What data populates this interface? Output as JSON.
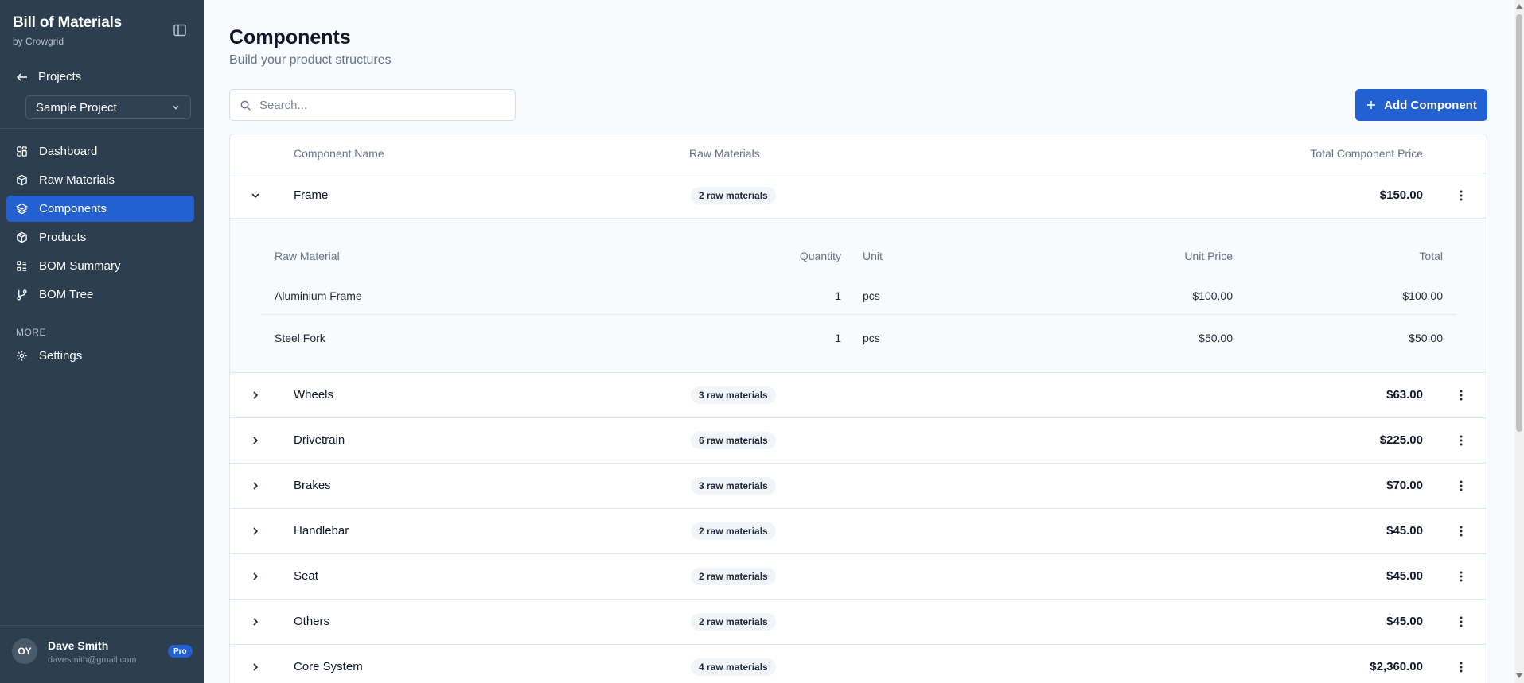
{
  "sidebar": {
    "brand_title": "Bill of Materials",
    "brand_sub": "by Crowgrid",
    "back_label": "Projects",
    "project_selected": "Sample Project",
    "nav": [
      {
        "label": "Dashboard",
        "icon": "dashboard-icon"
      },
      {
        "label": "Raw Materials",
        "icon": "box-icon"
      },
      {
        "label": "Components",
        "icon": "layers-icon",
        "active": true
      },
      {
        "label": "Products",
        "icon": "package-icon"
      },
      {
        "label": "BOM Summary",
        "icon": "list-icon"
      },
      {
        "label": "BOM Tree",
        "icon": "git-branch-icon"
      }
    ],
    "more_label": "MORE",
    "settings_label": "Settings",
    "user": {
      "initials": "OY",
      "name": "Dave Smith",
      "email": "davesmith@gmail.com",
      "plan": "Pro"
    }
  },
  "main": {
    "title": "Components",
    "subtitle": "Build your product structures",
    "search_placeholder": "Search...",
    "add_button": "Add Component",
    "columns": {
      "name": "Component Name",
      "materials": "Raw Materials",
      "price": "Total Component Price"
    },
    "components": [
      {
        "name": "Frame",
        "materials": "2 raw materials",
        "price": "$150.00",
        "expanded": true
      },
      {
        "name": "Wheels",
        "materials": "3 raw materials",
        "price": "$63.00"
      },
      {
        "name": "Drivetrain",
        "materials": "6 raw materials",
        "price": "$225.00"
      },
      {
        "name": "Brakes",
        "materials": "3 raw materials",
        "price": "$70.00"
      },
      {
        "name": "Handlebar",
        "materials": "2 raw materials",
        "price": "$45.00"
      },
      {
        "name": "Seat",
        "materials": "2 raw materials",
        "price": "$45.00"
      },
      {
        "name": "Others",
        "materials": "2 raw materials",
        "price": "$45.00"
      },
      {
        "name": "Core System",
        "materials": "4 raw materials",
        "price": "$2,360.00"
      }
    ],
    "detail": {
      "columns": {
        "material": "Raw Material",
        "quantity": "Quantity",
        "unit": "Unit",
        "unit_price": "Unit Price",
        "total": "Total"
      },
      "rows": [
        {
          "material": "Aluminium Frame",
          "quantity": "1",
          "unit": "pcs",
          "unit_price": "$100.00",
          "total": "$100.00"
        },
        {
          "material": "Steel Fork",
          "quantity": "1",
          "unit": "pcs",
          "unit_price": "$50.00",
          "total": "$50.00"
        }
      ]
    }
  },
  "colors": {
    "sidebar_bg": "#2d3e50",
    "accent": "#2360d1",
    "page_bg": "#f8fafc"
  }
}
